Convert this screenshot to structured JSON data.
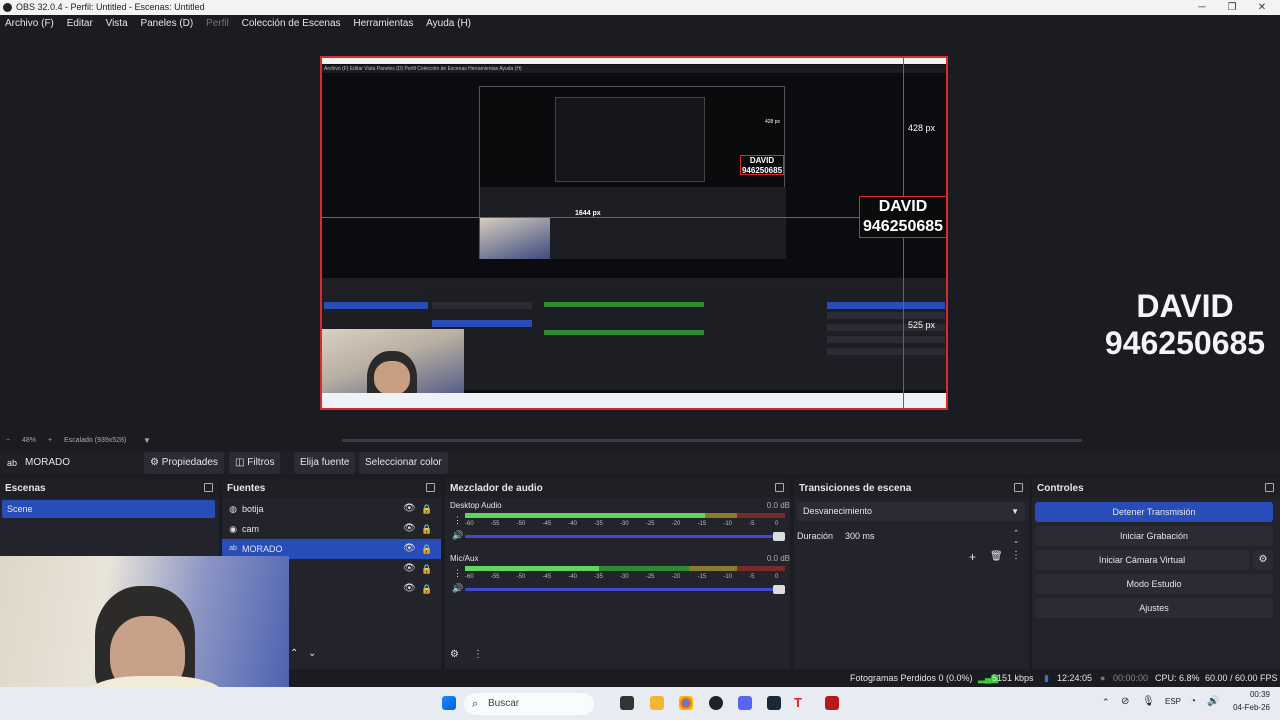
{
  "window": {
    "title": "OBS 32.0.4 - Perfil: Untitled - Escenas: Untitled",
    "minimize": "─",
    "maximize": "❐",
    "close": "✕"
  },
  "menu": [
    "Archivo (F)",
    "Editar",
    "Vista",
    "Paneles (D)",
    "Perfil",
    "Colección de Escenas",
    "Herramientas",
    "Ayuda (H)"
  ],
  "preview": {
    "overlay_name": "DAVID",
    "overlay_number": "946250685",
    "nested_name": "DAVID",
    "nested_number": "946250685",
    "measure_top": "428 px",
    "measure_right": "525 px",
    "measure_left": "1644 px",
    "nested_inner_top": "428 px",
    "nested_menu": "Archivo (F)   Editar   Vista   Paneles (D)   Perfil   Colección de Escenas   Herramientas   Ayuda (H)"
  },
  "zoom": {
    "minus": "−",
    "level": "48%",
    "plus": "+",
    "scaling": "Escalado (939x528)"
  },
  "source_toolbar": {
    "current_source": "MORADO",
    "properties": "Propiedades",
    "filters": "Filtros",
    "pick_source": "Elija fuente",
    "pick_color": "Seleccionar color"
  },
  "scenes": {
    "title": "Escenas",
    "items": [
      "Scene"
    ]
  },
  "sources": {
    "title": "Fuentes",
    "items": [
      {
        "name": "botija",
        "icon": "globe-icon"
      },
      {
        "name": "cam",
        "icon": "camera-icon"
      },
      {
        "name": "MORADO",
        "icon": "text-icon"
      },
      {
        "name": "",
        "icon": ""
      },
      {
        "name": "",
        "icon": ""
      }
    ]
  },
  "mixer": {
    "title": "Mezclador de audio",
    "channels": [
      {
        "name": "Desktop Audio",
        "db": "0.0 dB",
        "level": 0.75
      },
      {
        "name": "Mic/Aux",
        "db": "0.0 dB",
        "level": 0.42
      }
    ],
    "ticks": [
      "-60",
      "-55",
      "-50",
      "-45",
      "-40",
      "-35",
      "-30",
      "-25",
      "-20",
      "-15",
      "-10",
      "-5",
      "0"
    ]
  },
  "transitions": {
    "title": "Transiciones de escena",
    "selected": "Desvanecimiento",
    "duration_label": "Duración",
    "duration_value": "300 ms"
  },
  "controls": {
    "title": "Controles",
    "stop_stream": "Detener Transmisión",
    "start_record": "Iniciar Grabación",
    "start_virtual_cam": "Iniciar Cámara Virtual",
    "studio_mode": "Modo Estudio",
    "settings": "Ajustes"
  },
  "status": {
    "dropped_frames": "Fotogramas Perdidos 0 (0.0%)",
    "bitrate": "5151 kbps",
    "stream_time": "12:24:05",
    "record_time": "00:00:00",
    "cpu": "CPU: 6.8%",
    "fps": "60.00 / 60.00 FPS"
  },
  "taskbar": {
    "search_placeholder": "Buscar",
    "lang": "ESP",
    "time": "00:39",
    "date": "04-Feb-26"
  },
  "colors": {
    "accent": "#284cb8",
    "bg": "#1b1c21",
    "panel": "#23242b",
    "red_guides": "#e03030"
  }
}
